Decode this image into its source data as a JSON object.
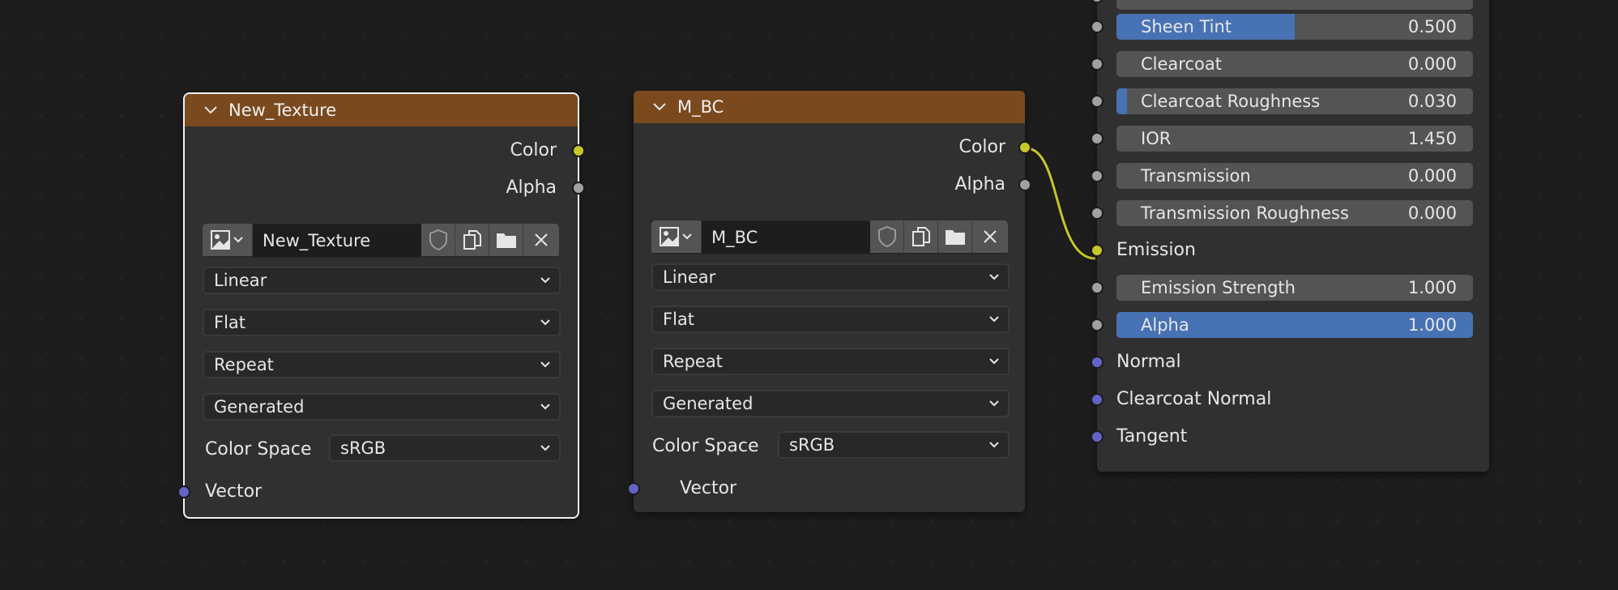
{
  "node_a": {
    "title": "New_Texture",
    "outputs": {
      "color": "Color",
      "alpha": "Alpha"
    },
    "image_name": "New_Texture",
    "interpolation": "Linear",
    "projection": "Flat",
    "extension": "Repeat",
    "source": "Generated",
    "color_space_label": "Color Space",
    "color_space": "sRGB",
    "input_vector": "Vector"
  },
  "node_b": {
    "title": "M_BC",
    "outputs": {
      "color": "Color",
      "alpha": "Alpha"
    },
    "image_name": "M_BC",
    "interpolation": "Linear",
    "projection": "Flat",
    "extension": "Repeat",
    "source": "Generated",
    "color_space_label": "Color Space",
    "color_space": "sRGB",
    "input_vector": "Vector"
  },
  "bsdf": {
    "sliders": [
      {
        "label": "Sheen Tint",
        "value": "0.500",
        "fill": 0.5
      },
      {
        "label": "Clearcoat",
        "value": "0.000",
        "fill": 0.0
      },
      {
        "label": "Clearcoat Roughness",
        "value": "0.030",
        "fill": 0.03
      },
      {
        "label": "IOR",
        "value": "1.450",
        "fill": 0.0
      },
      {
        "label": "Transmission",
        "value": "0.000",
        "fill": 0.0
      },
      {
        "label": "Transmission Roughness",
        "value": "0.000",
        "fill": 0.0
      }
    ],
    "emission": "Emission",
    "sliders2": [
      {
        "label": "Emission Strength",
        "value": "1.000",
        "fill": 0.0
      },
      {
        "label": "Alpha",
        "value": "1.000",
        "fill": 1.0
      }
    ],
    "normal": "Normal",
    "clearcoat_normal": "Clearcoat Normal",
    "tangent": "Tangent"
  },
  "colors": {
    "header": "#7a4a1e",
    "socket_color": "#c7c729",
    "socket_float": "#a1a1a1",
    "socket_vector": "#6363c7",
    "slider_fill": "#4772b3"
  }
}
